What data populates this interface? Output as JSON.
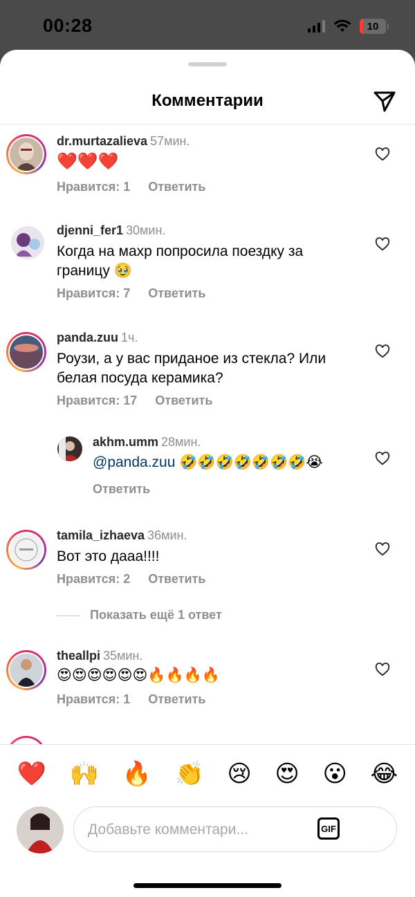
{
  "status_bar": {
    "time": "00:28",
    "battery": "10",
    "icons": [
      "signal-icon",
      "wifi-icon",
      "battery-icon"
    ]
  },
  "sheet": {
    "title": "Комментарии",
    "share_icon": "send-icon"
  },
  "comments": [
    {
      "username": "dr.murtazalieva",
      "time": "57мин.",
      "text": "❤️❤️❤️",
      "likes": "Нравится: 1",
      "reply": "Ответить"
    },
    {
      "username": "djenni_fer1",
      "time": "30мин.",
      "text": "Когда на махр попросила поездку за границу 🥹",
      "likes": "Нравится: 7",
      "reply": "Ответить"
    },
    {
      "username": "panda.zuu",
      "time": "1ч.",
      "text": "Роузи, а  у вас приданое из стекла? Или белая посуда керамика?",
      "likes": "Нравится: 17",
      "reply": "Ответить"
    },
    {
      "username": "akhm.umm",
      "time": "28мин.",
      "mention": "@panda.zuu",
      "text": "🤣🤣🤣🤣🤣🤣🤣😭",
      "reply": "Ответить"
    },
    {
      "username": "tamila_izhaeva",
      "time": "36мин.",
      "text": "Вот это дааа!!!!",
      "likes": "Нравится: 2",
      "reply": "Ответить"
    },
    {
      "username": "theallpi",
      "time": "35мин.",
      "text": "😍😍😍😍😍😍🔥🔥🔥🔥",
      "likes": "Нравится: 1",
      "reply": "Ответить"
    }
  ],
  "more_replies": "Показать ещё 1 ответ",
  "quick_emojis": [
    "❤️",
    "🙌",
    "🔥",
    "👏",
    "😢",
    "😍",
    "😮",
    "😂"
  ],
  "composer": {
    "placeholder": "Добавьте комментари...",
    "gif_label": "GIF"
  },
  "colors": {
    "text_secondary": "#8e8e8e",
    "mention": "#00376b",
    "status_bar_bg": "#4a4a4a"
  }
}
